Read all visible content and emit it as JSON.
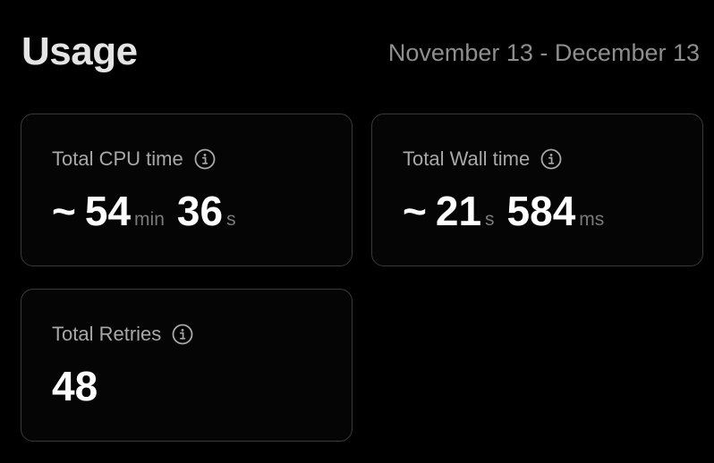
{
  "header": {
    "title": "Usage",
    "date_range": "November 13 - December 13"
  },
  "cards": [
    {
      "label": "Total CPU time",
      "icon": "info-icon",
      "approx": "~",
      "parts": [
        {
          "value": "54",
          "unit": "min"
        },
        {
          "value": "36",
          "unit": "s"
        }
      ]
    },
    {
      "label": "Total Wall time",
      "icon": "info-icon",
      "approx": "~",
      "parts": [
        {
          "value": "21",
          "unit": "s"
        },
        {
          "value": "584",
          "unit": "ms"
        }
      ]
    },
    {
      "label": "Total Retries",
      "icon": "info-icon",
      "value": "48"
    }
  ],
  "colors": {
    "background": "#000000",
    "card_border": "#3a3a3a",
    "title": "#e4e4e4",
    "muted": "#8e8e8e",
    "label": "#a8a8a8",
    "unit": "#7a7a7a",
    "value": "#ffffff"
  }
}
